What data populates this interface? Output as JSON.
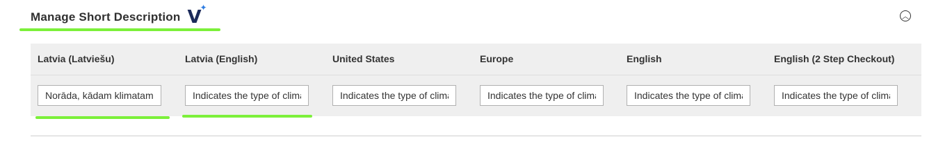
{
  "section": {
    "title": "Manage Short Description",
    "brand_letter": "V",
    "brand_spark": "✦",
    "collapse_symbol": "︿"
  },
  "table": {
    "headers": [
      "Latvia (Latviešu)",
      "Latvia (English)",
      "United States",
      "Europe",
      "English",
      "English (2 Step Checkout)"
    ],
    "values": [
      "Norāda, kādam klimatam",
      "Indicates the type of climate",
      "Indicates the type of climate",
      "Indicates the type of climate",
      "Indicates the type of climate",
      "Indicates the type of climate"
    ]
  },
  "colors": {
    "highlight": "#7cf03a",
    "brand": "#1b2a5a",
    "spark": "#2f7de1",
    "table_bg": "#efefef"
  }
}
